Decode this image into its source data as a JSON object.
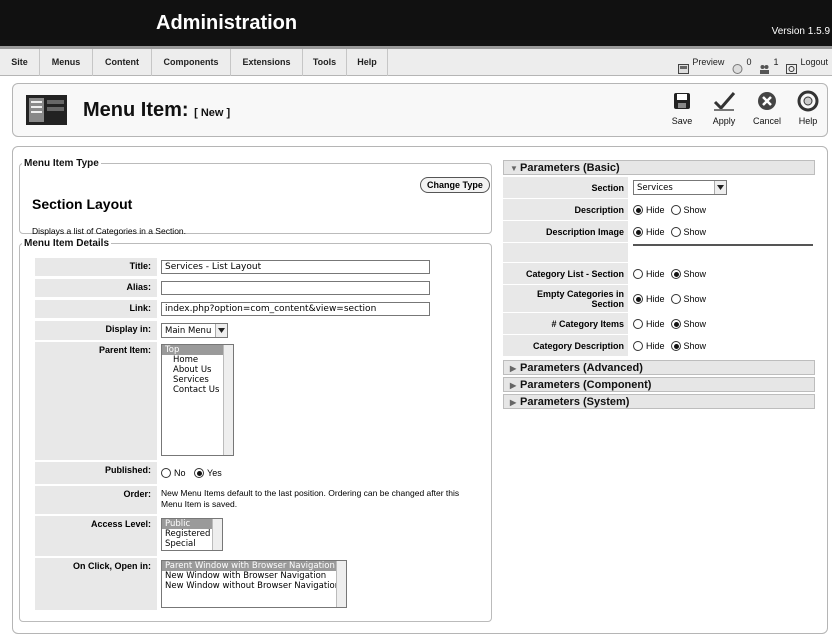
{
  "header": {
    "title": "Administration",
    "version": "Version 1.5.9"
  },
  "menu": {
    "items": [
      "Site",
      "Menus",
      "Content",
      "Components",
      "Extensions",
      "Tools",
      "Help"
    ]
  },
  "status": {
    "preview": "Preview",
    "messages": "0",
    "users": "1",
    "logout": "Logout"
  },
  "toolbar": {
    "title": "Menu Item:",
    "subtitle": "[ New ]",
    "save": "Save",
    "apply": "Apply",
    "cancel": "Cancel",
    "help": "Help"
  },
  "menu_item_type": {
    "legend": "Menu Item Type",
    "layout_title": "Section Layout",
    "description": "Displays a list of Categories in a Section.",
    "change_type": "Change Type"
  },
  "details": {
    "legend": "Menu Item Details",
    "title_label": "Title:",
    "title_value": "Services - List Layout",
    "alias_label": "Alias:",
    "alias_value": "",
    "link_label": "Link:",
    "link_value": "index.php?option=com_content&view=section",
    "display_in_label": "Display in:",
    "display_in_value": "Main Menu",
    "parent_label": "Parent Item:",
    "parent_options": [
      "Top",
      "Home",
      "About Us",
      "Services",
      "Contact Us"
    ],
    "published_label": "Published:",
    "published_no": "No",
    "published_yes": "Yes",
    "order_label": "Order:",
    "order_text": "New Menu Items default to the last position. Ordering can be changed after this Menu Item is saved.",
    "access_label": "Access Level:",
    "access_options": [
      "Public",
      "Registered",
      "Special"
    ],
    "onclick_label": "On Click, Open in:",
    "onclick_options": [
      "Parent Window with Browser Navigation",
      "New Window with Browser Navigation",
      "New Window without Browser Navigation"
    ]
  },
  "params_basic": {
    "header": "Parameters (Basic)",
    "section_label": "Section",
    "section_value": "Services",
    "description_label": "Description",
    "description_image_label": "Description Image",
    "category_list_label": "Category List - Section",
    "empty_categories_label": "Empty Categories in Section",
    "category_items_label": "# Category Items",
    "category_description_label": "Category Description",
    "hide": "Hide",
    "show": "Show"
  },
  "params_advanced": {
    "header": "Parameters (Advanced)"
  },
  "params_component": {
    "header": "Parameters (Component)"
  },
  "params_system": {
    "header": "Parameters (System)"
  }
}
